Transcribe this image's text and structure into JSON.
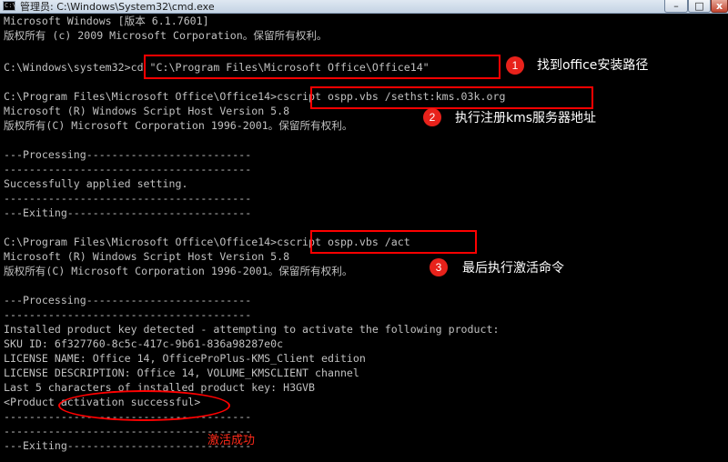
{
  "window": {
    "title": "管理员: C:\\Windows\\System32\\cmd.exe",
    "app_icon_text": "C:\\",
    "buttons": {
      "minimize": "–",
      "maximize": "□",
      "close": "x"
    }
  },
  "console": {
    "lines": [
      "Microsoft Windows [版本 6.1.7601]",
      "版权所有 (c) 2009 Microsoft Corporation。保留所有权利。",
      "",
      "C:\\Windows\\system32>cd \"C:\\Program Files\\Microsoft Office\\Office14\"",
      "",
      "C:\\Program Files\\Microsoft Office\\Office14>cscript ospp.vbs /sethst:kms.03k.org",
      "Microsoft (R) Windows Script Host Version 5.8",
      "版权所有(C) Microsoft Corporation 1996-2001。保留所有权利。",
      "",
      "---Processing--------------------------",
      "---------------------------------------",
      "Successfully applied setting.",
      "---------------------------------------",
      "---Exiting-----------------------------",
      "",
      "C:\\Program Files\\Microsoft Office\\Office14>cscript ospp.vbs /act",
      "Microsoft (R) Windows Script Host Version 5.8",
      "版权所有(C) Microsoft Corporation 1996-2001。保留所有权利。",
      "",
      "---Processing--------------------------",
      "---------------------------------------",
      "Installed product key detected - attempting to activate the following product:",
      "SKU ID: 6f327760-8c5c-417c-9b61-836a98287e0c",
      "LICENSE NAME: Office 14, OfficeProPlus-KMS_Client edition",
      "LICENSE DESCRIPTION: Office 14, VOLUME_KMSCLIENT channel",
      "Last 5 characters of installed product key: H3GVB",
      "<Product activation successful>",
      "---------------------------------------",
      "---------------------------------------",
      "---Exiting-----------------------------"
    ]
  },
  "annotations": {
    "step1": {
      "number": "1",
      "text": "找到office安装路径"
    },
    "step2": {
      "number": "2",
      "text": "执行注册kms服务器地址"
    },
    "step3": {
      "number": "3",
      "text": "最后执行激活命令"
    },
    "success_note": "激活成功"
  },
  "colors": {
    "console_bg": "#000000",
    "console_text": "#c0c0c0",
    "annotation_red": "#ff0000",
    "badge_red": "#e8221b"
  }
}
